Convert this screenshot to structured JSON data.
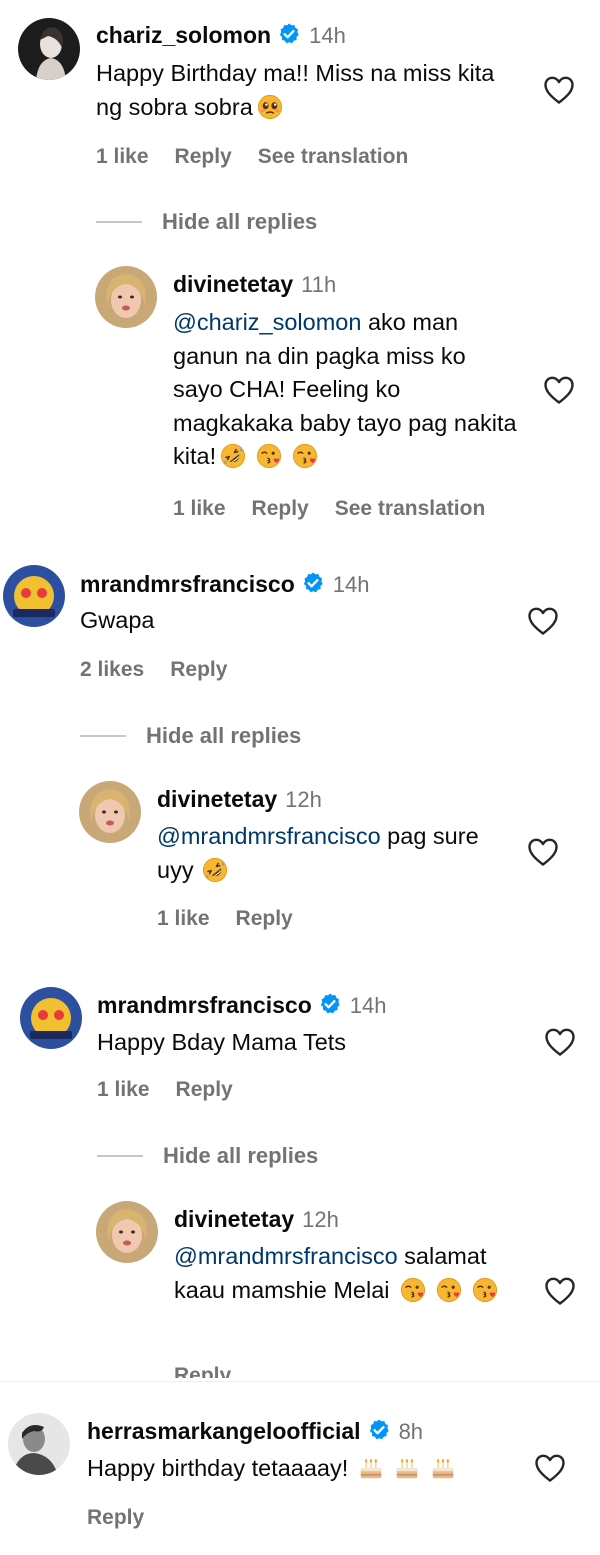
{
  "colors": {
    "verified": "#0095f6",
    "muted": "#737373",
    "mention": "#00376b",
    "text": "#0a0a0a"
  },
  "comments": [
    {
      "username": "chariz_solomon",
      "time": "14h",
      "text": "Happy Birthday ma!! Miss na miss kita ng sobra sobra",
      "likes": "1 like",
      "reply": "Reply",
      "translate": "See translation",
      "hide_replies": "Hide all replies",
      "replies": [
        {
          "username": "divinetetay",
          "time": "11h",
          "mention": "@chariz_solomon",
          "text": " ako man ganun na din pagka miss ko sayo CHA! Feeling ko magkakaka baby tayo pag nakita kita!",
          "likes": "1 like",
          "reply": "Reply",
          "translate": "See translation"
        }
      ]
    },
    {
      "username": "mrandmrsfrancisco",
      "time": "14h",
      "text": "Gwapa",
      "likes": "2 likes",
      "reply": "Reply",
      "hide_replies": "Hide all replies",
      "replies": [
        {
          "username": "divinetetay",
          "time": "12h",
          "mention": "@mrandmrsfrancisco",
          "text": " pag sure uyy",
          "likes": "1 like",
          "reply": "Reply"
        }
      ]
    },
    {
      "username": "mrandmrsfrancisco",
      "time": "14h",
      "text": "Happy Bday Mama Tets",
      "likes": "1 like",
      "reply": "Reply",
      "hide_replies": "Hide all replies",
      "replies": [
        {
          "username": "divinetetay",
          "time": "12h",
          "mention": "@mrandmrsfrancisco",
          "text": " salamat kaau mamshie Melai",
          "reply": "Reply"
        }
      ]
    },
    {
      "username": "herrasmarkangeloofficial",
      "time": "8h",
      "text": "Happy birthday tetaaaay!",
      "reply": "Reply"
    }
  ]
}
